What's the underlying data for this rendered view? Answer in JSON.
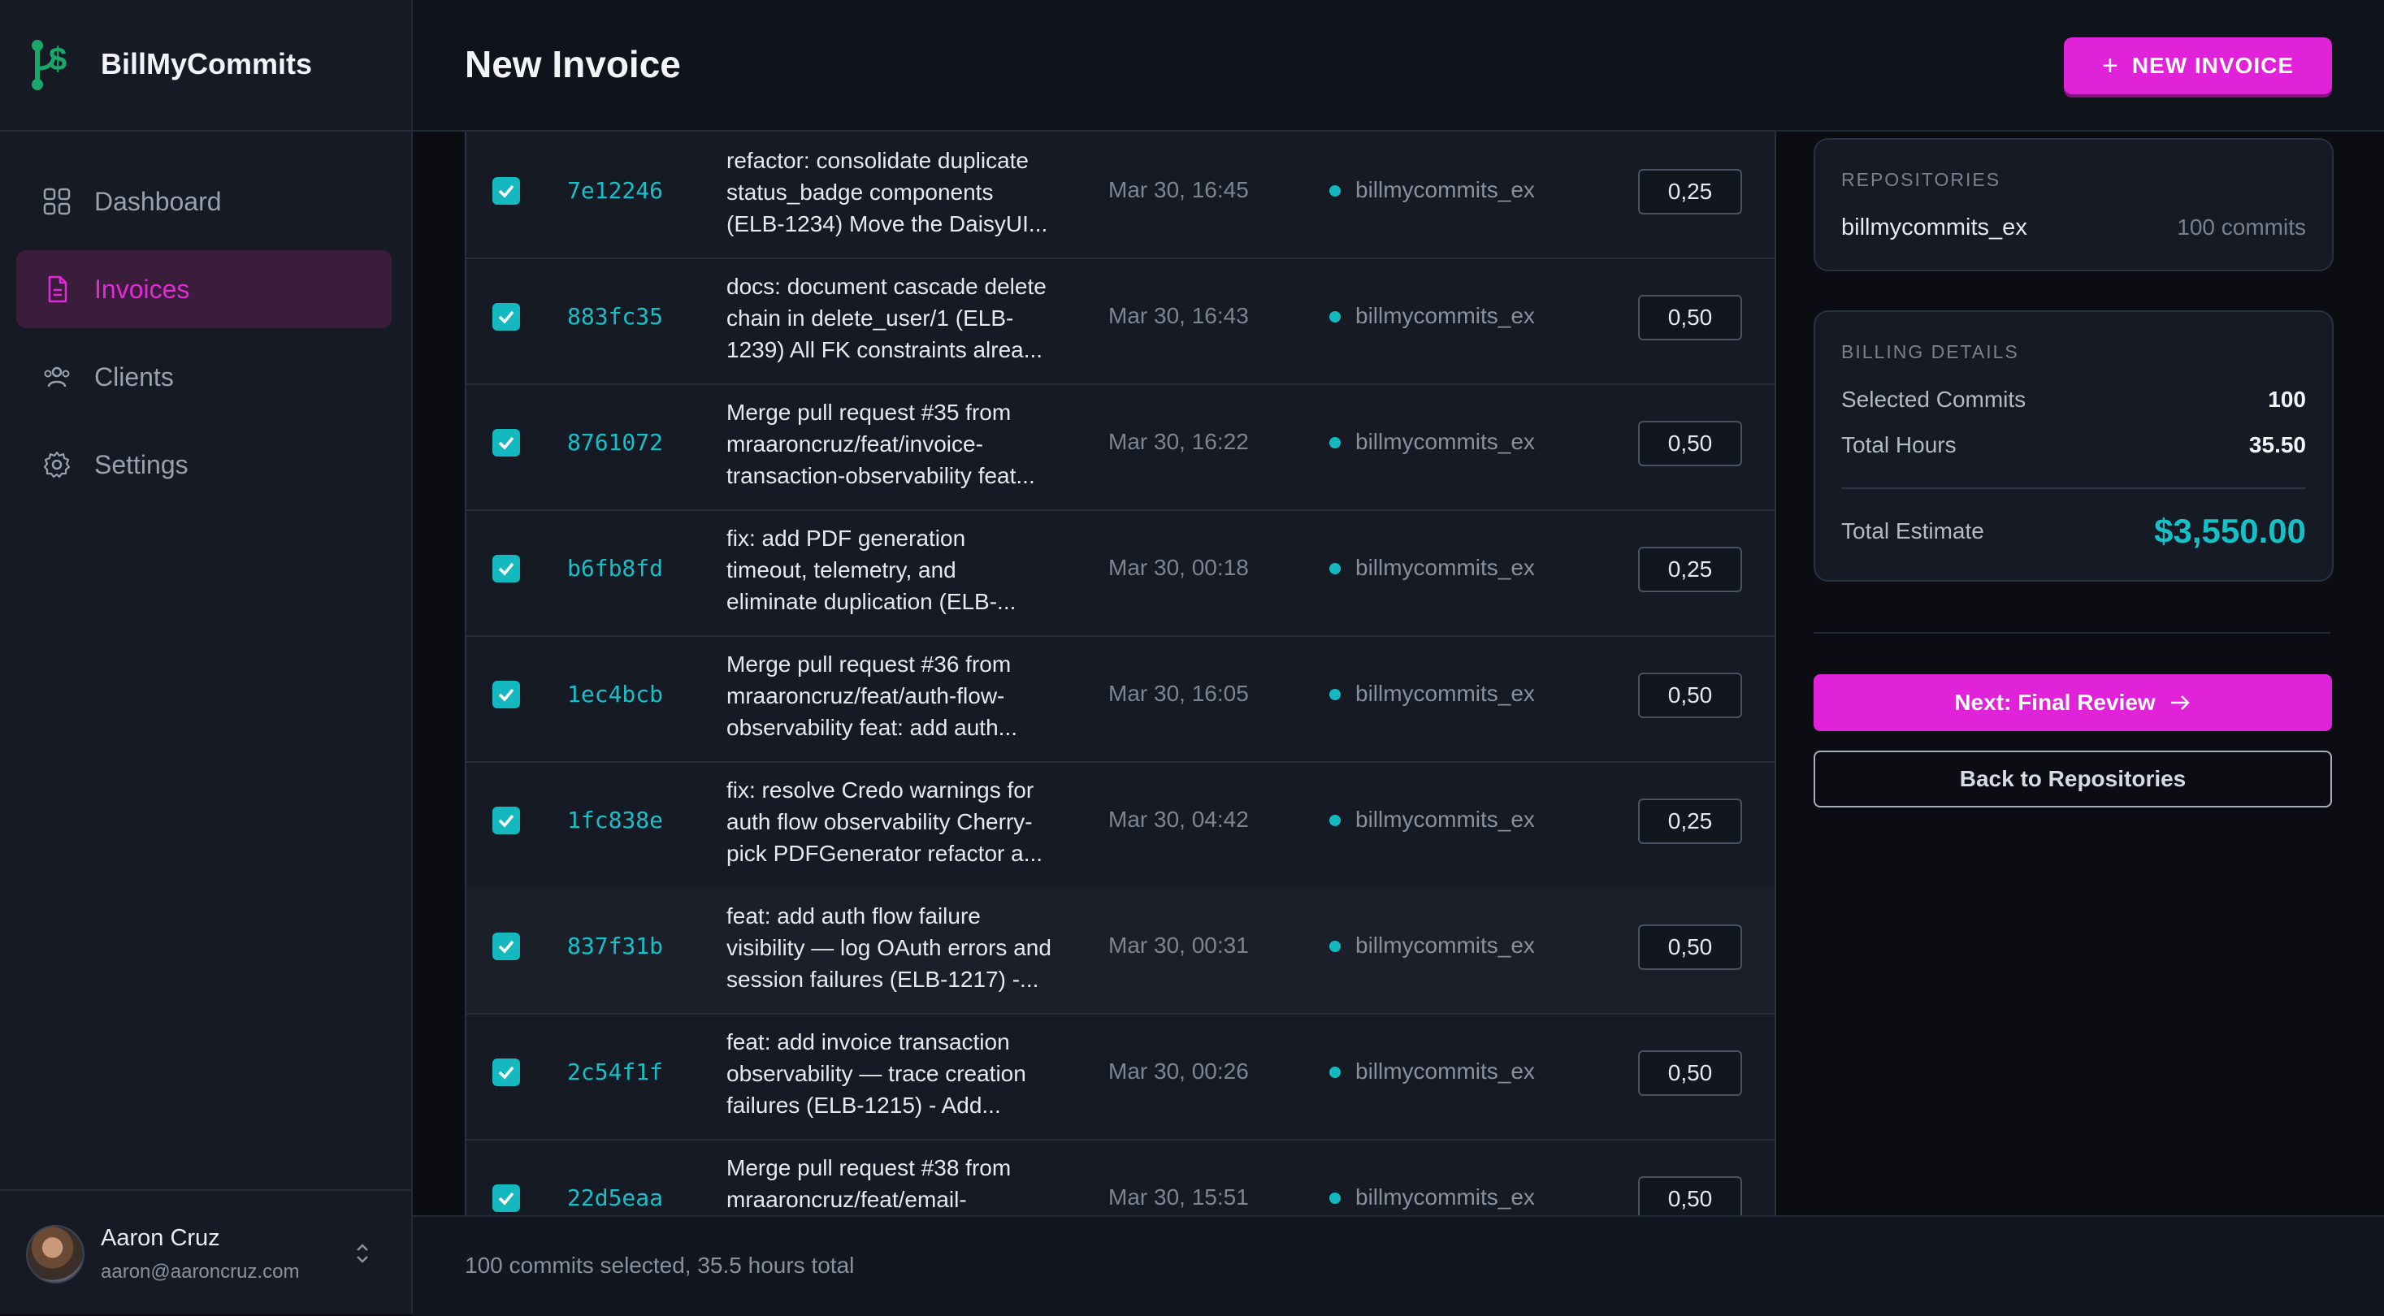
{
  "app": {
    "name": "BillMyCommits"
  },
  "sidebar": {
    "items": [
      {
        "label": "Dashboard",
        "icon": "grid-icon"
      },
      {
        "label": "Invoices",
        "icon": "document-icon",
        "active": true
      },
      {
        "label": "Clients",
        "icon": "users-icon"
      },
      {
        "label": "Settings",
        "icon": "gear-icon"
      }
    ],
    "user": {
      "name": "Aaron Cruz",
      "email": "aaron@aaroncruz.com"
    }
  },
  "header": {
    "title": "New Invoice",
    "new_invoice_label": "NEW INVOICE"
  },
  "commits": [
    {
      "hash": "7e12246",
      "message": "refactor: consolidate duplicate\nstatus_badge components\n(ELB-1234) Move the DaisyUI...",
      "date": "Mar 30, 16:45",
      "repo": "billmycommits_ex",
      "hours": "0,25",
      "selected": true
    },
    {
      "hash": "883fc35",
      "message": "docs: document cascade delete\nchain in delete_user/1 (ELB-\n1239) All FK constraints alrea...",
      "date": "Mar 30, 16:43",
      "repo": "billmycommits_ex",
      "hours": "0,50",
      "selected": true
    },
    {
      "hash": "8761072",
      "message": "Merge pull request #35 from\nmraaroncruz/feat/invoice-\ntransaction-observability feat...",
      "date": "Mar 30, 16:22",
      "repo": "billmycommits_ex",
      "hours": "0,50",
      "selected": true
    },
    {
      "hash": "b6fb8fd",
      "message": "fix: add PDF generation\ntimeout, telemetry, and\neliminate duplication (ELB-...",
      "date": "Mar 30, 00:18",
      "repo": "billmycommits_ex",
      "hours": "0,25",
      "selected": true
    },
    {
      "hash": "1ec4bcb",
      "message": "Merge pull request #36 from\nmraaroncruz/feat/auth-flow-\nobservability feat: add auth...",
      "date": "Mar 30, 16:05",
      "repo": "billmycommits_ex",
      "hours": "0,50",
      "selected": true
    },
    {
      "hash": "1fc838e",
      "message": "fix: resolve Credo warnings for\nauth flow observability Cherry-\npick PDFGenerator refactor a...",
      "date": "Mar 30, 04:42",
      "repo": "billmycommits_ex",
      "hours": "0,25",
      "selected": true
    },
    {
      "hash": "837f31b",
      "message": "feat: add auth flow failure\nvisibility — log OAuth errors and\nsession failures (ELB-1217) -...",
      "date": "Mar 30, 00:31",
      "repo": "billmycommits_ex",
      "hours": "0,50",
      "selected": true
    },
    {
      "hash": "2c54f1f",
      "message": "feat: add invoice transaction\nobservability — trace creation\nfailures (ELB-1215) - Add...",
      "date": "Mar 30, 00:26",
      "repo": "billmycommits_ex",
      "hours": "0,50",
      "selected": true
    },
    {
      "hash": "22d5eaa",
      "message": "Merge pull request #38 from\nmraaroncruz/feat/email-",
      "date": "Mar 30, 15:51",
      "repo": "billmycommits_ex",
      "hours": "0,50",
      "selected": true
    }
  ],
  "footer": {
    "summary": "100 commits selected, 35.5 hours total"
  },
  "repositories": {
    "label": "REPOSITORIES",
    "items": [
      {
        "name": "billmycommits_ex",
        "count": "100 commits"
      }
    ]
  },
  "billing": {
    "label": "BILLING DETAILS",
    "selected_label": "Selected Commits",
    "selected_value": "100",
    "hours_label": "Total Hours",
    "hours_value": "35.50",
    "total_label": "Total Estimate",
    "total_value": "$3,550.00"
  },
  "actions": {
    "next_label": "Next: Final Review",
    "back_label": "Back to Repositories"
  },
  "colors": {
    "accent": "#e022d8",
    "teal": "#14b9bf",
    "background": "#0b0d13",
    "panel": "#151a25"
  }
}
